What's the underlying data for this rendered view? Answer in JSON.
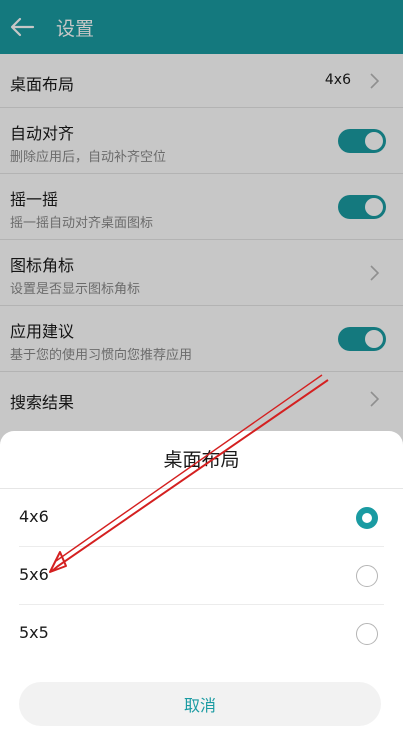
{
  "appbar": {
    "title": "设置"
  },
  "settings": [
    {
      "title": "桌面布局",
      "value": "4x6",
      "control": "chevron"
    },
    {
      "title": "自动对齐",
      "subtitle": "删除应用后，自动补齐空位",
      "control": "toggle",
      "on": true
    },
    {
      "title": "摇一摇",
      "subtitle": "摇一摇自动对齐桌面图标",
      "control": "toggle",
      "on": true
    },
    {
      "title": "图标角标",
      "subtitle": "设置是否显示图标角标",
      "control": "chevron"
    },
    {
      "title": "应用建议",
      "subtitle": "基于您的使用习惯向您推荐应用",
      "control": "toggle",
      "on": true
    },
    {
      "title": "搜索结果",
      "control": "chevron"
    }
  ],
  "dialog": {
    "title": "桌面布局",
    "options": [
      {
        "label": "4x6",
        "selected": true
      },
      {
        "label": "5x6",
        "selected": false
      },
      {
        "label": "5x5",
        "selected": false
      }
    ],
    "cancel_label": "取消"
  },
  "colors": {
    "accent": "#1a9ba2",
    "annotation_arrow": "#d42020"
  }
}
